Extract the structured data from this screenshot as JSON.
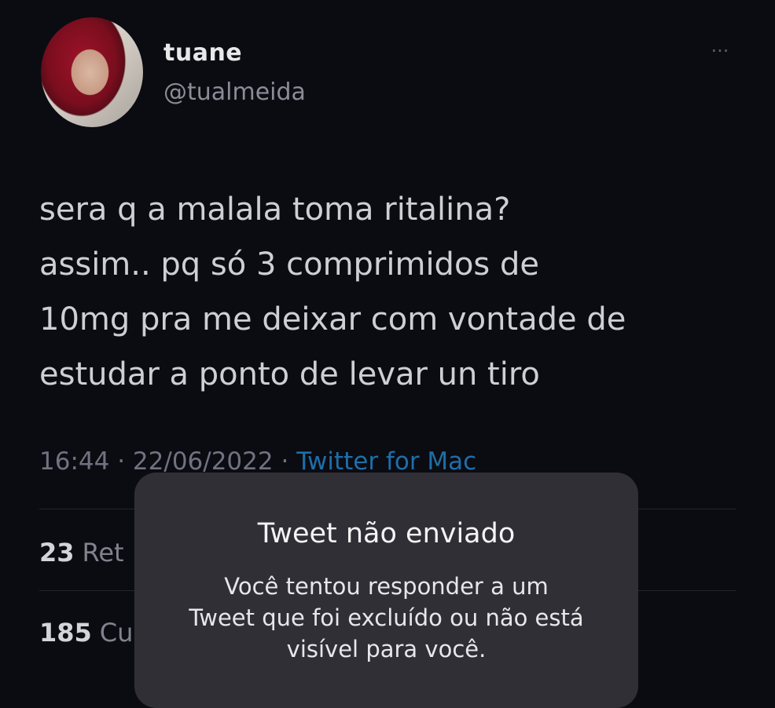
{
  "author": {
    "display_name": "tuane",
    "handle": "@tualmeida"
  },
  "tweet": {
    "text": "sera q a malala toma ritalina?\nassim.. pq só 3 comprimidos de\n10mg pra me deixar com vontade de\nestudar a ponto de levar un tiro",
    "time": "16:44",
    "separator1": "·",
    "date": "22/06/2022",
    "separator2": "·",
    "source": "Twitter for Mac"
  },
  "stats": {
    "retweets": {
      "count": "23",
      "label_partial": "Ret"
    },
    "likes": {
      "count": "185",
      "label_partial": "Cu"
    }
  },
  "toast": {
    "title": "Tweet não enviado",
    "message": "Você tentou responder a um\nTweet que foi excluído ou não está\nvisível para você."
  },
  "icons": {
    "more": "more-dots-icon"
  },
  "colors": {
    "background": "#0b0b12",
    "link": "#1d6fa8",
    "toast_background": "#302f35"
  }
}
